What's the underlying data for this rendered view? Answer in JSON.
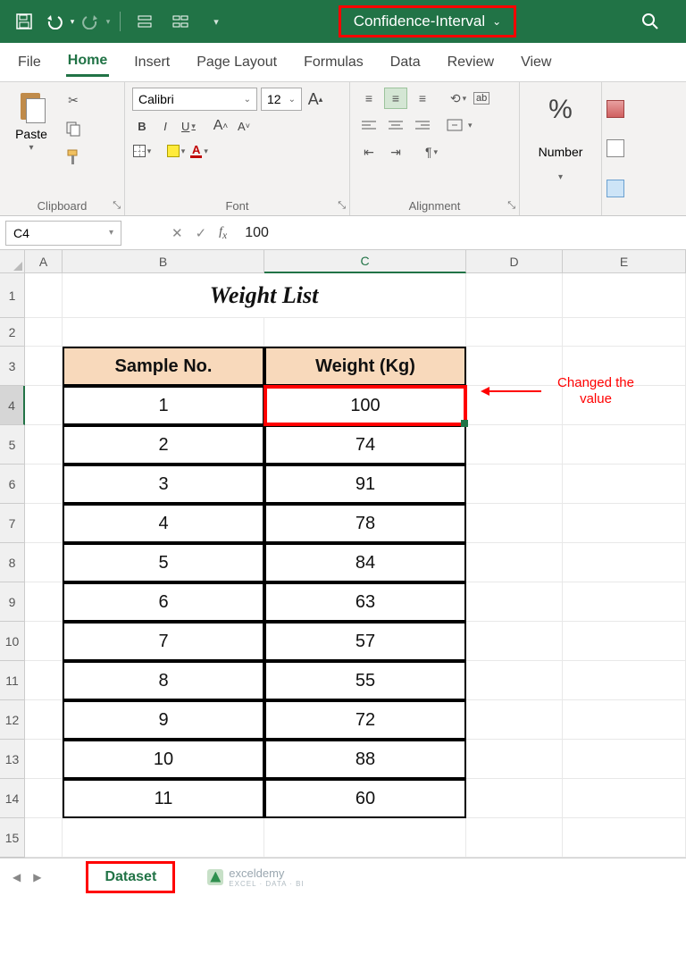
{
  "titlebar": {
    "doc_name": "Confidence-Interval"
  },
  "tabs": [
    "File",
    "Home",
    "Insert",
    "Page Layout",
    "Formulas",
    "Data",
    "Review",
    "View"
  ],
  "active_tab": "Home",
  "font": {
    "name": "Calibri",
    "size": "12"
  },
  "clipboard": {
    "paste_label": "Paste",
    "group_label": "Clipboard"
  },
  "font_group_label": "Font",
  "align_group_label": "Alignment",
  "number_group": {
    "label": "Number"
  },
  "namebox": "C4",
  "formula_value": "100",
  "columns": [
    "A",
    "B",
    "C",
    "D",
    "E"
  ],
  "row_numbers": [
    "1",
    "2",
    "3",
    "4",
    "5",
    "6",
    "7",
    "8",
    "9",
    "10",
    "11",
    "12",
    "13",
    "14",
    "15"
  ],
  "title_text": "Weight List",
  "headers": {
    "sample": "Sample No.",
    "weight": "Weight (Kg)"
  },
  "data_rows": [
    {
      "n": "1",
      "w": "100"
    },
    {
      "n": "2",
      "w": "74"
    },
    {
      "n": "3",
      "w": "91"
    },
    {
      "n": "4",
      "w": "78"
    },
    {
      "n": "5",
      "w": "84"
    },
    {
      "n": "6",
      "w": "63"
    },
    {
      "n": "7",
      "w": "57"
    },
    {
      "n": "8",
      "w": "55"
    },
    {
      "n": "9",
      "w": "72"
    },
    {
      "n": "10",
      "w": "88"
    },
    {
      "n": "11",
      "w": "60"
    }
  ],
  "annotation": "Changed the value",
  "sheet_tab": "Dataset",
  "watermark": {
    "name": "exceldemy",
    "tag": "EXCEL · DATA · BI"
  }
}
